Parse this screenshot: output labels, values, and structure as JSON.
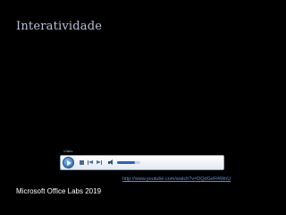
{
  "slide": {
    "title": "Interatividade"
  },
  "player": {
    "title": "Vídeo",
    "volume_level": 0.75,
    "icons": {
      "play": "play-icon",
      "stop": "stop-icon",
      "previous": "previous-icon",
      "next": "next-icon",
      "volume": "volume-icon"
    }
  },
  "link": {
    "url_text": "http://www.youtube.com/watch?v=DQdGeR4WnU"
  },
  "footer": {
    "text": "Microsoft Office Labs 2019"
  },
  "colors": {
    "background": "#000000",
    "title": "#b8c2d8",
    "link": "#5b8fd6",
    "player_accent": "#2a63b8"
  }
}
